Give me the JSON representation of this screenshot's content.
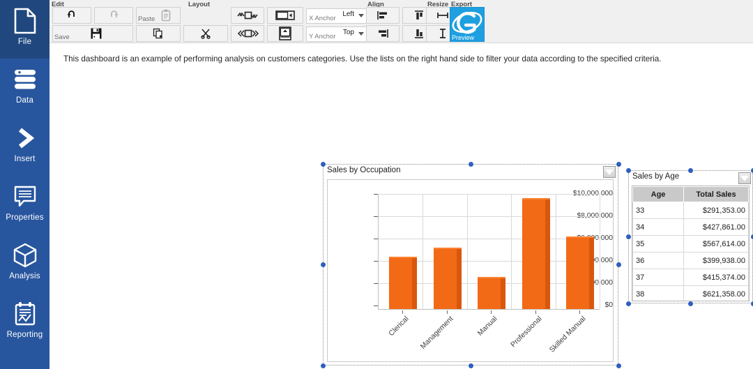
{
  "sidebar": {
    "items": [
      {
        "label": "File",
        "icon": "file-icon",
        "selected": true
      },
      {
        "label": "Data",
        "icon": "database-icon",
        "selected": false
      },
      {
        "label": "Insert",
        "icon": "chevron-right-icon",
        "selected": false
      },
      {
        "label": "Properties",
        "icon": "comment-lines-icon",
        "selected": false
      },
      {
        "label": "Analysis",
        "icon": "cube-icon",
        "selected": false
      },
      {
        "label": "Reporting",
        "icon": "clipboard-chart-icon",
        "selected": false
      }
    ]
  },
  "ribbon": {
    "groups": [
      {
        "title": "Edit"
      },
      {
        "title": "Layout"
      },
      {
        "title": "Align"
      },
      {
        "title": "Resize"
      },
      {
        "title": "Export"
      }
    ],
    "edit": {
      "undo_label": "",
      "undo_icon": "undo-arrow-icon",
      "redo_label": "",
      "redo_icon": "redo-arrow-icon",
      "paste_label": "Paste",
      "paste_icon": "clipboard-icon",
      "save_label": "Save",
      "save_icon": "floppy-disk-icon",
      "copy_label": "",
      "copy_icon": "copy-pages-icon",
      "cut_label": "",
      "cut_icon": "scissors-icon"
    },
    "layout": {
      "bring_forward_icon": "move-vertical-icon",
      "send_backward_icon": "move-horizontal-icon",
      "dock_horizontal_icon": "dock-right-icon",
      "dock_vertical_icon": "dock-top-icon",
      "x_anchor_label": "X Anchor",
      "x_anchor_value": "Left",
      "y_anchor_label": "Y Anchor",
      "y_anchor_value": "Top"
    },
    "align": {
      "align_left_icon": "align-left-icon",
      "align_top_icon": "align-top-icon",
      "align_center_h_icon": "align-center-horizontal-icon",
      "align_right_icon": "align-right-icon",
      "align_bottom_icon": "align-bottom-icon",
      "align_center_v_icon": "align-center-vertical-icon"
    },
    "resize": {
      "same_width_icon": "same-width-icon",
      "same_height_icon": "same-height-icon"
    },
    "export": {
      "label": "Preview",
      "icon": "internet-explorer-icon",
      "color": "#1e9fe0"
    }
  },
  "canvas": {
    "description": "This dashboard is an example of performing analysis on customers categories. Use the lists on the right hand side to filter your data according to the specified criteria."
  },
  "chart_widget": {
    "title": "Sales by Occupation",
    "filter_icon": "filter-dropdown-icon"
  },
  "table_widget": {
    "title": "Sales by Age",
    "filter_icon": "filter-dropdown-icon",
    "columns": [
      "Age",
      "Total Sales"
    ],
    "rows": [
      {
        "age": "33",
        "sales": "$291,353.00"
      },
      {
        "age": "34",
        "sales": "$427,861.00"
      },
      {
        "age": "35",
        "sales": "$567,614.00"
      },
      {
        "age": "36",
        "sales": "$399,938.00"
      },
      {
        "age": "37",
        "sales": "$415,374.00"
      },
      {
        "age": "38",
        "sales": "$621,358.00"
      }
    ]
  },
  "chart_data": {
    "type": "bar",
    "title": "Sales by Occupation",
    "xlabel": "",
    "ylabel": "",
    "categories": [
      "Clerical",
      "Management",
      "Manual",
      "Professional",
      "Skilled Manual"
    ],
    "values": [
      4670000,
      5500000,
      2900000,
      9950000,
      6500000
    ],
    "ylim": [
      0,
      11000000
    ],
    "yticks": [
      0,
      2000000,
      4000000,
      6000000,
      8000000,
      10000000
    ],
    "ytick_labels": [
      "$0",
      "$2,000,000",
      "$4,000,000",
      "$6,000,000",
      "$8,000,000",
      "$10,000,000"
    ],
    "grid": true,
    "legend": false,
    "bar_color": "#f26a16",
    "bar_shade_color": "#d9570c"
  }
}
